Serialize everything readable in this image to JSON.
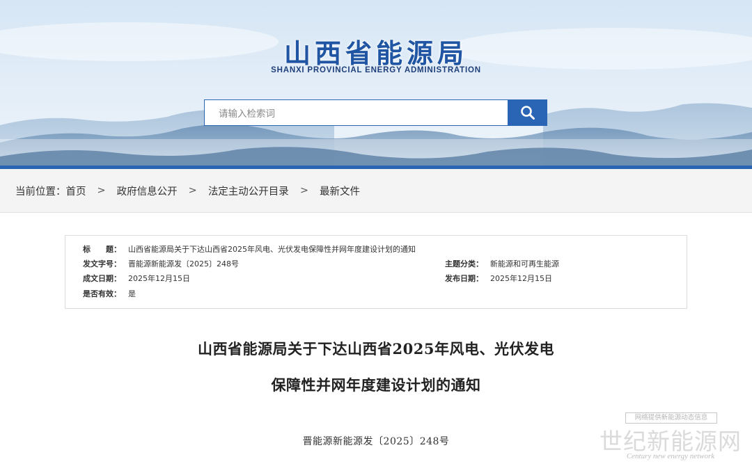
{
  "header": {
    "logo_cn": "山西省能源局",
    "logo_en": "SHANXI PROVINCIAL ENERGY ADMINISTRATION",
    "search": {
      "placeholder": "请输入检索词"
    }
  },
  "breadcrumb": {
    "label": "当前位置：",
    "items": [
      "首页",
      "政府信息公开",
      "法定主动公开目录",
      "最新文件"
    ],
    "separator": ">"
  },
  "meta": {
    "title_label": "标　　题：",
    "title_value": "山西省能源局关于下达山西省2025年风电、光伏发电保障性并网年度建设计划的通知",
    "docno_label": "发文字号：",
    "docno_value": "晋能源新能源发〔2025〕248号",
    "category_label": "主题分类：",
    "category_value": "新能源和可再生能源",
    "created_label": "成文日期：",
    "created_value": "2025年12月15日",
    "published_label": "发布日期：",
    "published_value": "2025年12月15日",
    "valid_label": "是否有效：",
    "valid_value": "是"
  },
  "article": {
    "title_line1": "山西省能源局关于下达山西省2025年风电、光伏发电",
    "title_line2": "保障性并网年度建设计划的通知",
    "doc_number": "晋能源新能源发〔2025〕248号"
  },
  "watermark": {
    "tagline": "网络提供新能源动态信息",
    "name": "世纪新能源网",
    "english": "Century new energy network"
  },
  "colors": {
    "brand_blue": "#2a64b4",
    "logo_blue": "#1f55a3"
  }
}
